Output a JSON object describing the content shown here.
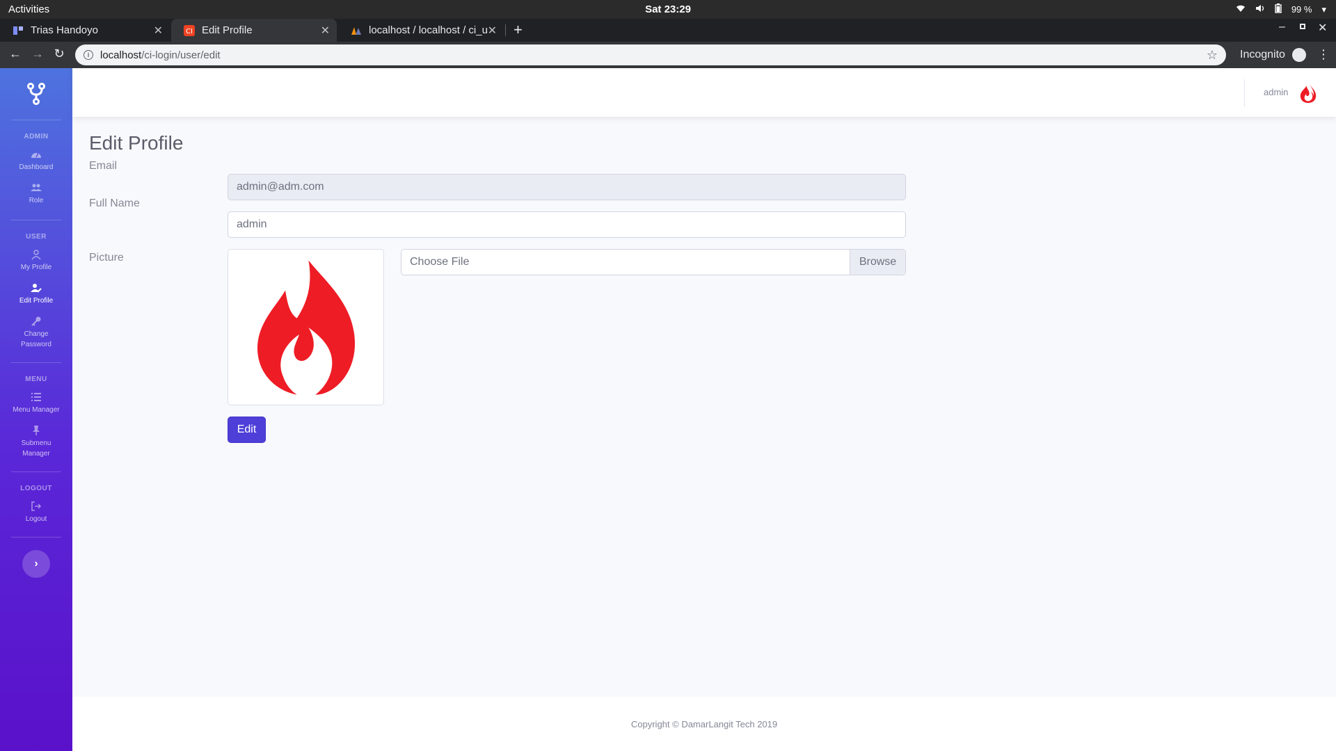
{
  "os_bar": {
    "activities": "Activities",
    "clock": "Sat 23:29",
    "battery": "99 %"
  },
  "browser": {
    "tabs": [
      {
        "title": "Trias Handoyo",
        "favicon": "figma-like-icon"
      },
      {
        "title": "Edit Profile",
        "favicon": "codeigniter-icon"
      },
      {
        "title": "localhost / localhost / ci_u",
        "favicon": "phpmyadmin-icon"
      }
    ],
    "url_host": "localhost",
    "url_path": "/ci-login/user/edit",
    "incognito": "Incognito"
  },
  "sidebar": {
    "sections": [
      {
        "heading": "ADMIN",
        "items": [
          {
            "label": "Dashboard",
            "icon": "dashboard-icon"
          },
          {
            "label": "Role",
            "icon": "users-icon"
          }
        ]
      },
      {
        "heading": "USER",
        "items": [
          {
            "label": "My Profile",
            "icon": "user-icon"
          },
          {
            "label": "Edit Profile",
            "icon": "user-edit-icon",
            "active": true
          },
          {
            "label": "Change Password",
            "icon": "key-icon"
          }
        ]
      },
      {
        "heading": "MENU",
        "items": [
          {
            "label": "Menu Manager",
            "icon": "list-icon"
          },
          {
            "label": "Submenu Manager",
            "icon": "thumbtack-icon"
          }
        ]
      },
      {
        "heading": "LOGOUT",
        "items": [
          {
            "label": "Logout",
            "icon": "sign-out-icon"
          }
        ]
      }
    ]
  },
  "topbar": {
    "username": "admin"
  },
  "page": {
    "title": "Edit Profile",
    "email_label": "Email",
    "email_value": "admin@adm.com",
    "fullname_label": "Full Name",
    "fullname_value": "admin",
    "picture_label": "Picture",
    "file_placeholder": "Choose File",
    "browse_label": "Browse",
    "edit_button": "Edit"
  },
  "footer": {
    "copyright": "Copyright © DamarLangit Tech 2019"
  },
  "colors": {
    "brand_primary": "#4e73df",
    "sidebar_bottom": "#5a11c9",
    "button": "#4e3fd8",
    "logo_red": "#ee1c25"
  }
}
